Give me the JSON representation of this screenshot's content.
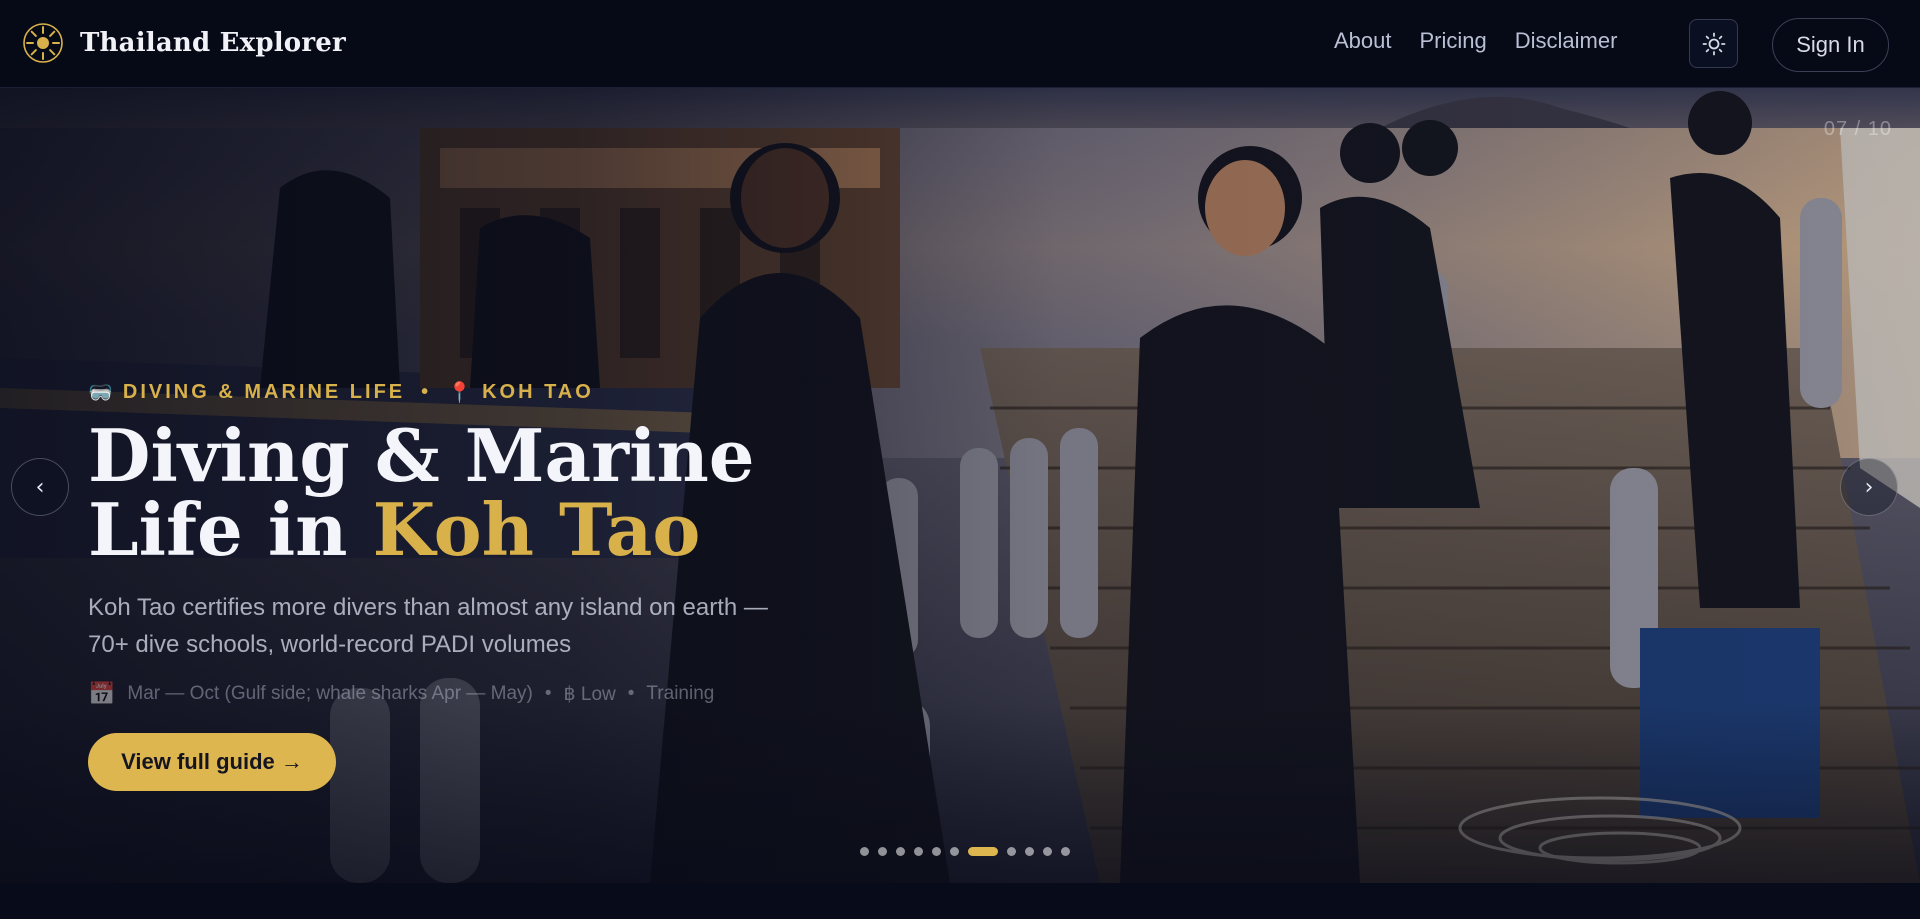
{
  "brand": {
    "name": "Thailand Explorer",
    "logo_icon": "sun-compass-icon"
  },
  "nav": {
    "items": [
      "About",
      "Pricing",
      "Disclaimer"
    ]
  },
  "header": {
    "theme_toggle_icon": "sun-icon",
    "signin_label": "Sign In"
  },
  "hero": {
    "counter": "07 / 10",
    "eyebrow": {
      "category_icon": "🥽",
      "category": "DIVING & MARINE LIFE",
      "separator": "•",
      "location_icon": "📍",
      "location": "KOH TAO"
    },
    "title_line1": "Diving & Marine",
    "title_line2_prefix": "Life in ",
    "title_accent": "Koh Tao",
    "description": "Koh Tao certifies more divers than almost any island on earth — 70+ dive schools, world-record PADI volumes",
    "meta": {
      "calendar_icon": "📅",
      "season": "Mar — Oct (Gulf side; whale sharks Apr — May)",
      "budget": "฿ Low",
      "type": "Training",
      "separator": "•"
    },
    "cta_label": "View full guide →",
    "prev_arrow": "‹",
    "next_arrow": "›",
    "slides_total": 11,
    "active_slide": 6
  },
  "colors": {
    "accent": "#ddb650",
    "background": "#070a18",
    "header": "#060916"
  }
}
